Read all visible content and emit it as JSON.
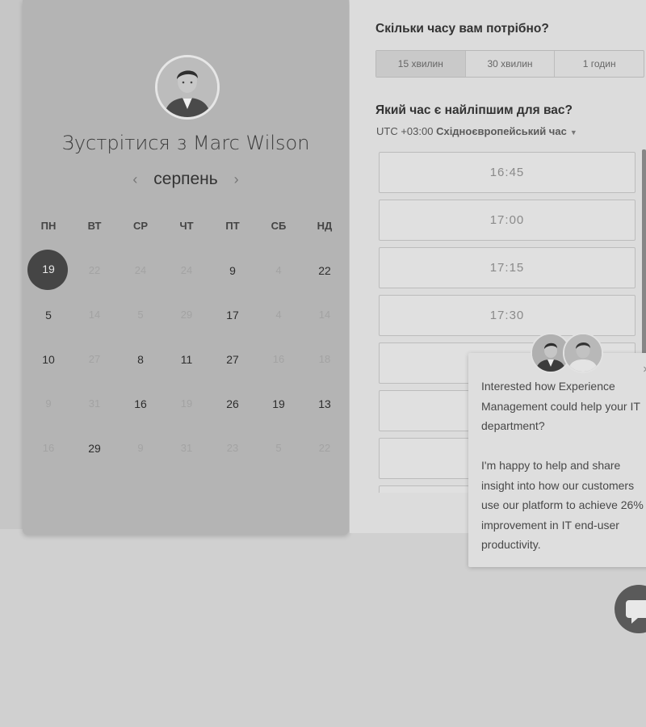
{
  "calendar": {
    "title": "Зустрітися з Marc Wilson",
    "month": "серпень",
    "prev_icon": "‹",
    "next_icon": "›",
    "weekdays": [
      "ПН",
      "ВТ",
      "СР",
      "ЧТ",
      "ПТ",
      "СБ",
      "НД"
    ],
    "weeks": [
      [
        "19",
        "22",
        "24",
        "24",
        "9",
        "4",
        "22"
      ],
      [
        "5",
        "14",
        "5",
        "29",
        "17",
        "4",
        "14"
      ],
      [
        "10",
        "27",
        "8",
        "11",
        "27",
        "16",
        "18"
      ],
      [
        "9",
        "31",
        "16",
        "19",
        "26",
        "19",
        "13"
      ],
      [
        "16",
        "29",
        "9",
        "31",
        "23",
        "5",
        "22"
      ]
    ],
    "selected_day": "19"
  },
  "booking": {
    "duration_question": "Скільки часу вам потрібно?",
    "durations": [
      "15 хвилин",
      "30 хвилин",
      "1 годин"
    ],
    "selected_duration": "15 хвилин",
    "time_question": "Який час є найліпшим для вас?",
    "timezone_prefix": "UTC +03:00",
    "timezone_name": "Східноєвропейський час",
    "slots": [
      "16:45",
      "17:00",
      "17:15",
      "17:30",
      "",
      "",
      ""
    ]
  },
  "popup": {
    "text1": "Interested how Experience Management could help your IT department?",
    "text2": "I'm happy to help and share insight into how our customers use our platform to achieve 26% improvement in IT end-user productivity.",
    "close_icon": "×"
  },
  "icons": {
    "chat": "chat-icon",
    "dropdown": "caret-down-icon"
  },
  "colors": {
    "selected_day": "#454545",
    "panel_bg": "#b4b4b4",
    "right_bg": "#dcdcdc"
  }
}
